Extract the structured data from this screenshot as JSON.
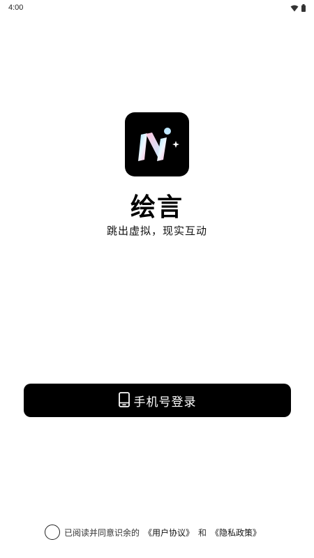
{
  "status_bar": {
    "time": "4:00",
    "icons": [
      "wifi-icon",
      "battery-icon"
    ]
  },
  "app": {
    "logo_icon": "app-logo-icon",
    "name": "绘言",
    "slogan": "跳出虚拟，现实互动"
  },
  "login": {
    "icon": "phone-icon",
    "label": "手机号登录"
  },
  "agreement": {
    "prefix": "已阅读并同意识余的",
    "user_agreement": "《用户协议》",
    "conjunction": "和",
    "privacy_policy": "《隐私政策》"
  },
  "colors": {
    "background": "#ffffff",
    "primary": "#000000",
    "button_text": "#ffffff"
  }
}
